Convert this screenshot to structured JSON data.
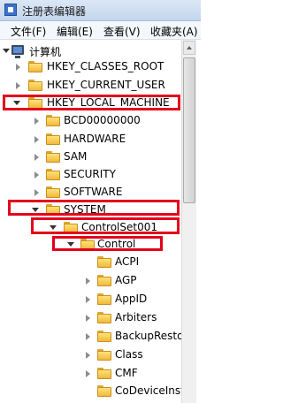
{
  "window": {
    "title": "注册表编辑器"
  },
  "menu": {
    "file": "文件(F)",
    "edit": "编辑(E)",
    "view": "查看(V)",
    "favorites": "收藏夹(A)"
  },
  "tree": {
    "root": "计算机",
    "nodes": [
      {
        "label": "HKEY_CLASSES_ROOT"
      },
      {
        "label": "HKEY_CURRENT_USER"
      },
      {
        "label": "HKEY_LOCAL_MACHINE"
      },
      {
        "label": "BCD00000000"
      },
      {
        "label": "HARDWARE"
      },
      {
        "label": "SAM"
      },
      {
        "label": "SECURITY"
      },
      {
        "label": "SOFTWARE"
      },
      {
        "label": "SYSTEM"
      },
      {
        "label": "ControlSet001"
      },
      {
        "label": "Control"
      },
      {
        "label": "ACPI"
      },
      {
        "label": "AGP"
      },
      {
        "label": "AppID"
      },
      {
        "label": "Arbiters"
      },
      {
        "label": "BackupResto"
      },
      {
        "label": "Class"
      },
      {
        "label": "CMF"
      },
      {
        "label": "CoDeviceInst"
      }
    ]
  },
  "colors": {
    "highlight_border": "#e3001b",
    "folder": "#f0b93b",
    "titlebar": "#c3d5ec"
  }
}
